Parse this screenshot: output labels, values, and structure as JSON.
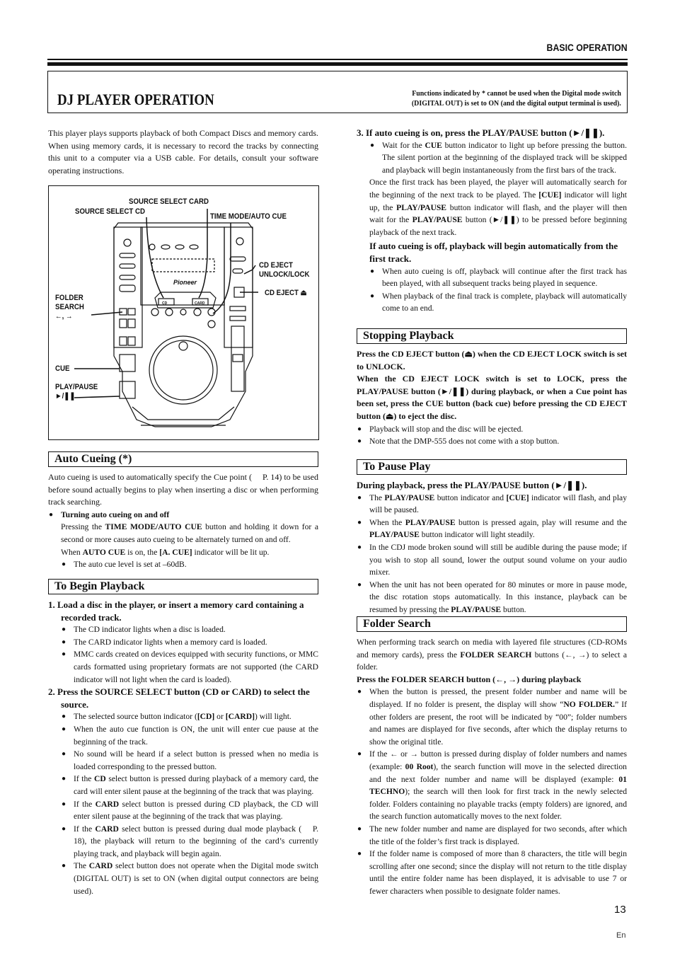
{
  "header": {
    "section_label": "BASIC OPERATION",
    "title": "DJ PLAYER OPERATION",
    "note_line1": "Functions indicated by * cannot be used when the Digital mode switch",
    "note_line2": "(DIGITAL OUT) is set to ON (and the digital output terminal is used)."
  },
  "intro": "This player plays supports playback of both Compact Discs and memory cards. When using memory cards, it is necessary to record the tracks by connecting this unit to a computer via a USB cable. For details, consult your software operating instructions.",
  "figure": {
    "labels": {
      "source_select_card": "SOURCE SELECT CARD",
      "source_select_cd": "SOURCE SELECT CD",
      "time_mode_auto_cue": "TIME MODE/AUTO CUE",
      "cd_eject_unlock_lock_1": "CD EJECT",
      "cd_eject_unlock_lock_2": "UNLOCK/LOCK",
      "cd_eject": "CD EJECT ⏏",
      "folder_search_1": "FOLDER",
      "folder_search_2": "SEARCH",
      "folder_search_3": "←, →",
      "cue": "CUE",
      "play_pause_1": "PLAY/PAUSE",
      "play_pause_2": "►/❚❚"
    },
    "device": {
      "brand": "Pioneer",
      "btn_cd": "CD",
      "btn_card": "CARD",
      "btn_cue": "CUE"
    }
  },
  "auto_cueing": {
    "heading": "Auto Cueing (*)",
    "body": "Auto cueing is used to automatically specify the Cue point (  P. 14) to be used before sound actually begins to play when inserting a disc or when performing track searching.",
    "bullet_heading": "Turning auto cueing on and off",
    "b_p1": "Pressing the ",
    "b_k1": "TIME MODE/AUTO CUE",
    "b_p2": " button and holding it down for a second or more causes auto cueing to be alternately turned on and off.",
    "b_p3": "When ",
    "b_k2": "AUTO CUE",
    "b_p4": " is on, the ",
    "b_k3": "[A. CUE]",
    "b_p5": " indicator will be lit up.",
    "sub_bullet": "The auto cue level is set at –60dB."
  },
  "begin_playback": {
    "heading": "To Begin Playback",
    "step1": "1. Load a disc in the player, or insert a memory card containing a recorded track.",
    "step1_bullets": [
      "The CD indicator lights when a disc is loaded.",
      "The CARD indicator lights when a memory card is loaded.",
      "MMC cards created on devices equipped with security functions, or MMC cards formatted using proprietary formats are not supported (the CARD indicator will not light when the card is loaded)."
    ],
    "step2": "2. Press the SOURCE SELECT button (CD or CARD) to select the source.",
    "step2_b1_a": "The selected source button indicator (",
    "step2_b1_k1": "[CD]",
    "step2_b1_b": " or ",
    "step2_b1_k2": "[CARD]",
    "step2_b1_c": ") will light.",
    "step2_b2": "When the auto cue function is ON, the unit will enter cue pause at the beginning of the track.",
    "step2_b3": "No sound will be heard if a select button is pressed when no media is loaded corresponding to the pressed button.",
    "step2_b4_a": "If the ",
    "step2_b4_k": "CD",
    "step2_b4_b": " select button is pressed during playback of a memory card, the card will enter silent pause at the beginning of the track that was playing.",
    "step2_b5_a": "If the ",
    "step2_b5_k": "CARD",
    "step2_b5_b": " select button is pressed during CD playback, the CD will enter silent pause at the beginning of the track that was playing.",
    "step2_b6_a": "If the ",
    "step2_b6_k": "CARD",
    "step2_b6_b": " select button is pressed during dual mode playback (  P. 18), the playback will return to the beginning of the card’s currently playing track, and playback will begin again.",
    "step2_b7_a": "The ",
    "step2_b7_k": "CARD",
    "step2_b7_b": " select button does not operate when the Digital mode switch (DIGITAL OUT) is set to ON (when digital output connectors are being used).",
    "step3": "3. If auto cueing is on, press the PLAY/PAUSE button (►/❚❚).",
    "step3_b1_a": "Wait for the ",
    "step3_b1_k": "CUE",
    "step3_b1_b": " button indicator to light up before pressing the button. The silent portion at the beginning of the displayed track will be skipped and playback will begin instantaneously from the first bars of the track.",
    "step3_p_a": "Once the first track has been played, the player will automatically search for the beginning of the next track to be played. The ",
    "step3_p_k1": "[CUE]",
    "step3_p_b": " indicator will light up, the ",
    "step3_p_k2": "PLAY/PAUSE",
    "step3_p_c": " button indicator will flash, and the player will then wait for the ",
    "step3_p_k3": "PLAY/PAUSE",
    "step3_p_d": " button (►/❚❚) to be pressed before beginning playback of the next track.",
    "off_heading": "If auto cueing is off, playback will begin automatically from the first track.",
    "off_bullets": [
      "When auto cueing is off, playback will continue after the first track has been played, with all subsequent tracks being played in sequence.",
      "When playback of the final track is complete, playback will automatically come to an end."
    ]
  },
  "stopping": {
    "heading": "Stopping Playback",
    "bold_p1": "Press the CD EJECT button (⏏) when the CD EJECT LOCK switch is set to UNLOCK.",
    "bold_p2": "When the CD EJECT LOCK switch is set to LOCK, press the PLAY/PAUSE button (►/❚❚) during playback, or when a Cue point has been set, press the CUE button (back cue) before pressing the CD EJECT button (⏏) to eject the disc.",
    "bullets": [
      "Playback will stop and the disc will be ejected.",
      "Note that the DMP-555 does not come with a stop button."
    ]
  },
  "pause": {
    "heading": "To Pause Play",
    "lead": "During playback, press the PLAY/PAUSE button (►/❚❚).",
    "b1_a": "The ",
    "b1_k1": "PLAY/PAUSE",
    "b1_b": " button indicator and ",
    "b1_k2": "[CUE]",
    "b1_c": " indicator will flash, and play will be paused.",
    "b2_a": "When the ",
    "b2_k1": "PLAY/PAUSE",
    "b2_b": " button is pressed again, play will resume and the ",
    "b2_k2": "PLAY/PAUSE",
    "b2_c": " button indicator will light steadily.",
    "b3": "In the CDJ mode broken sound will still be audible during the pause mode; if you wish to stop all sound, lower the output sound volume on your audio mixer.",
    "b4_a": "When the unit has not been operated for 80 minutes or more in pause mode, the disc rotation stops automatically. In this instance, playback can be resumed by pressing the ",
    "b4_k": "PLAY/PAUSE",
    "b4_b": " button."
  },
  "folder_search": {
    "heading": "Folder Search",
    "intro_a": "When performing track search on media with layered file structures (CD-ROMs and memory cards), press the ",
    "intro_k": "FOLDER SEARCH",
    "intro_b": " buttons (←, →) to select a folder.",
    "lead": "Press the FOLDER SEARCH button (←, →) during playback",
    "b1_a": "When the button is pressed, the present folder number and name will be displayed. If no folder is present, the display will show “",
    "b1_k": "NO FOLDER.",
    "b1_b": "” If other folders are present, the root will be indicated by “00”; folder numbers and names are displayed for five seconds, after which the display returns to show the original title.",
    "b2_a": "If the ← or → button is pressed during display of folder numbers and names (example: ",
    "b2_k1": "00 Root",
    "b2_b": "), the search function will move in the selected direction and the next folder number and name will be displayed (example: ",
    "b2_k2": "01 TECHNO",
    "b2_c": "); the search will then look for first track in the newly selected folder. Folders containing no playable tracks (empty folders) are ignored, and the search function automatically moves to the next folder.",
    "b3": "The new folder number and name are displayed for two seconds, after which the title of the folder’s first track is displayed.",
    "b4": "If the folder name is composed of more than 8 characters, the title will begin scrolling after one second; since the display will not return to the title display until the entire folder name has been displayed, it is advisable to use 7 or fewer characters when possible to designate folder names."
  },
  "footer": {
    "page_number": "13",
    "language": "En"
  }
}
